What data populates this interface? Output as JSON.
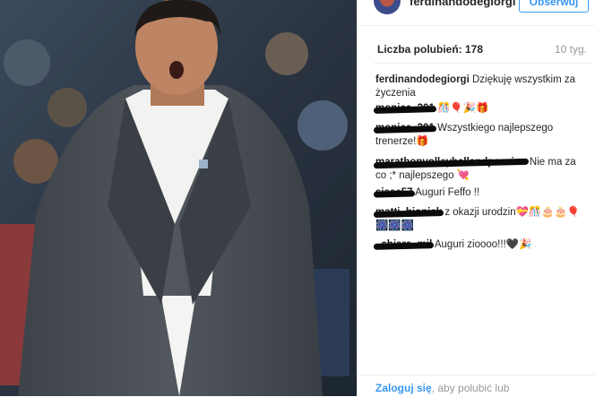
{
  "header": {
    "username": "ferdinandodegiorgi",
    "follow_label": "Obserwuj"
  },
  "post": {
    "likes": "Liczba polubień: 178",
    "time": "10 tyg."
  },
  "comments": [
    {
      "user": "ferdinandodegiorgi",
      "text": "Dziękuję wszystkim za życzenia"
    },
    {
      "user": "monica_301",
      "text": "🎊🎈🎉🎁"
    },
    {
      "user": "monica_301",
      "text": "Wszystkiego najlepszego trenerze!🎁"
    },
    {
      "user": "marathonvolleyballandpassion",
      "text": "Nie ma za co ;* najlepszego 💘"
    },
    {
      "user": "sisse57",
      "text": "Auguri Feffo !!"
    },
    {
      "user": "matti_bionick",
      "text": "z okazji urodzin💝🎊🎂🎂🎈🎆🎆🎆"
    },
    {
      "user": "_chiara_mil",
      "text": "Auguri zioooo!!!🖤🎉"
    }
  ],
  "footer": {
    "login_link": "Zaloguj się",
    "login_rest": ", aby polubić lub"
  }
}
